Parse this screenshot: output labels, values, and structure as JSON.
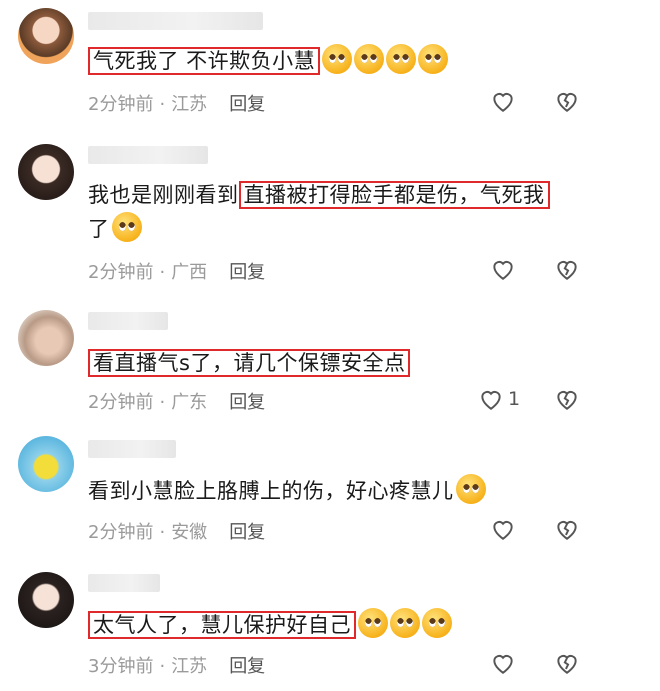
{
  "comments": [
    {
      "segments": [
        {
          "text": "气死我了 不许欺负小慧",
          "hl": true
        }
      ],
      "emojis": 4,
      "time": "2分钟前",
      "location": "江苏",
      "reply": "回复",
      "likes": ""
    },
    {
      "line1_pre": "我也是刚刚看到",
      "line1_hl": "直播被打得脸手都是伤，气死我",
      "line2": "了",
      "time": "2分钟前",
      "location": "广西",
      "reply": "回复",
      "likes": ""
    },
    {
      "segments": [
        {
          "text": "看直播气s了，请几个保镖安全点",
          "hl": true
        }
      ],
      "emojis": 0,
      "time": "2分钟前",
      "location": "广东",
      "reply": "回复",
      "likes": "1"
    },
    {
      "segments": [
        {
          "text": "看到小慧脸上胳膊上的伤，好心疼慧儿",
          "hl": false
        }
      ],
      "emojis": 1,
      "time": "2分钟前",
      "location": "安徽",
      "reply": "回复",
      "likes": ""
    },
    {
      "segments": [
        {
          "text": "太气人了，慧儿保护好自己",
          "hl": true
        }
      ],
      "emojis": 3,
      "time": "3分钟前",
      "location": "江苏",
      "reply": "回复",
      "likes": ""
    }
  ]
}
